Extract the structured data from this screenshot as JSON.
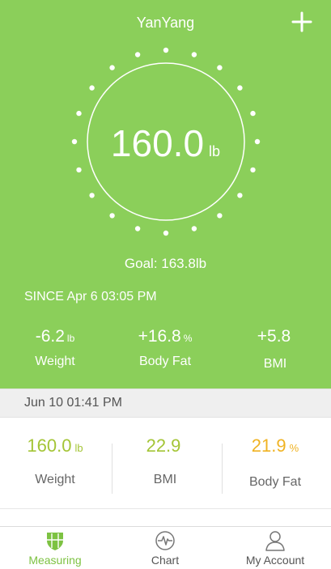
{
  "header": {
    "title": "YanYang",
    "add_icon": "plus-icon"
  },
  "current": {
    "weight": "160.0",
    "unit": "lb",
    "goal": "Goal: 163.8lb"
  },
  "since": "SINCE Apr 6 03:05 PM",
  "changes": [
    {
      "value": "-6.2",
      "unit": "lb",
      "label": "Weight"
    },
    {
      "value": "+16.8",
      "unit": "%",
      "label": "Body Fat"
    },
    {
      "value": "+5.8",
      "unit": "",
      "label": "BMI"
    }
  ],
  "record": {
    "date": "Jun 10 01:41 PM",
    "items": [
      {
        "value": "160.0",
        "unit": "lb",
        "label": "Weight",
        "color": "#a4c536"
      },
      {
        "value": "22.9",
        "unit": "",
        "label": "BMI",
        "color": "#a4c536"
      },
      {
        "value": "21.9",
        "unit": "%",
        "label": "Body Fat",
        "color": "#f0b323"
      }
    ]
  },
  "tabs": [
    {
      "label": "Measuring",
      "icon": "shield-icon",
      "active": true
    },
    {
      "label": "Chart",
      "icon": "pulse-icon",
      "active": false
    },
    {
      "label": "My Account",
      "icon": "user-icon",
      "active": false
    }
  ],
  "colors": {
    "header_bg": "#8bcf5a",
    "active_tab": "#7dc242",
    "inactive_tab": "#555555"
  }
}
